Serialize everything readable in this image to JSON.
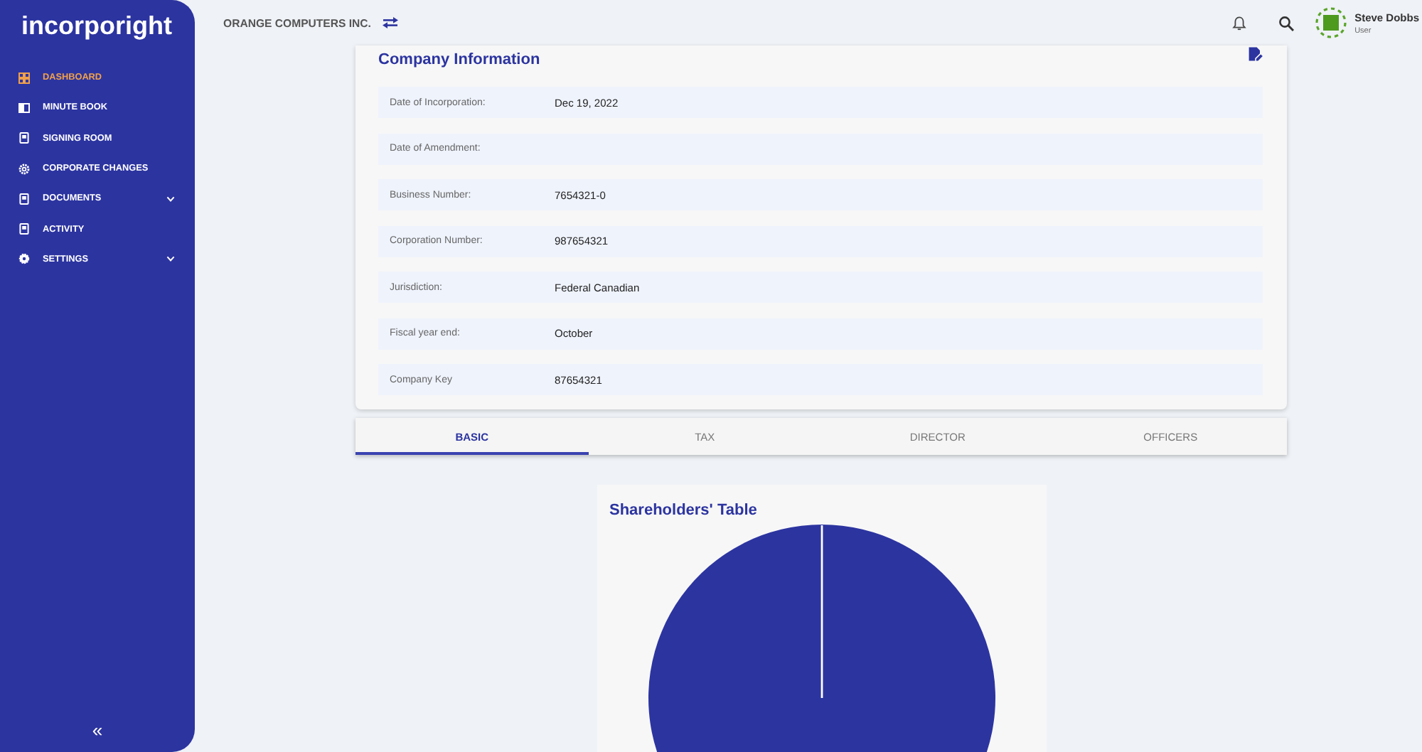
{
  "sidebar": {
    "logo": "incorporight",
    "items": [
      {
        "label": "DASHBOARD",
        "selected": true,
        "expandable": false
      },
      {
        "label": "MINUTE BOOK",
        "selected": false,
        "expandable": false
      },
      {
        "label": "SIGNING ROOM",
        "selected": false,
        "expandable": false
      },
      {
        "label": "CORPORATE CHANGES",
        "selected": false,
        "expandable": false
      },
      {
        "label": "DOCUMENTS",
        "selected": false,
        "expandable": true
      },
      {
        "label": "ACTIVITY",
        "selected": false,
        "expandable": false
      },
      {
        "label": "SETTINGS",
        "selected": false,
        "expandable": true
      }
    ],
    "collapse": "«"
  },
  "top_bar": {
    "company": "ORANGE COMPUTERS INC.",
    "user": {
      "name": "Steve Dobbs",
      "role": "User"
    }
  },
  "company_information": {
    "title": "Company Information",
    "fields": [
      {
        "label": "Date of Incorporation:",
        "value": "Dec 19, 2022"
      },
      {
        "label": "Date of Amendment:"
      },
      {
        "label": "Business Number:",
        "value": "7654321-0"
      },
      {
        "label": "Corporation Number:",
        "value": "987654321"
      },
      {
        "label": "Jurisdiction:",
        "value": "Federal Canadian"
      },
      {
        "label": "Fiscal year end:",
        "value": "October"
      },
      {
        "label": "Company Key",
        "value": "87654321"
      }
    ]
  },
  "tabs": [
    {
      "label": "BASIC",
      "selected": true
    },
    {
      "label": "TAX",
      "selected": false
    },
    {
      "label": "DIRECTOR",
      "selected": false
    },
    {
      "label": "OFFICERS",
      "selected": false
    }
  ],
  "shareholders": {
    "title": "Shareholders' Table"
  }
}
